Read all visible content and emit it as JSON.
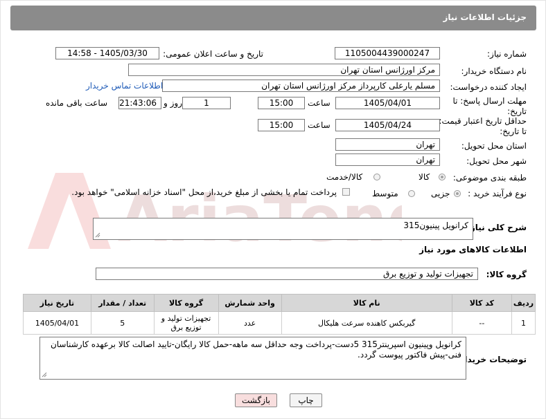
{
  "header": {
    "title": "جزئیات اطلاعات نیاز"
  },
  "form": {
    "need_number": {
      "label": "شماره نیاز:",
      "value": "1105004439000247"
    },
    "announce": {
      "label": "تاریخ و ساعت اعلان عمومی:",
      "value": "1405/03/30 - 14:58"
    },
    "buyer_org": {
      "label": "نام دستگاه خریدار:",
      "value": "مرکز اورژانس استان تهران"
    },
    "requester": {
      "label": "ایجاد کننده درخواست:",
      "value": "مسلم یارعلی کارپرداز مرکز اورژانس استان تهران",
      "contact_link": "اطلاعات تماس خریدار"
    },
    "reply_deadline": {
      "label": "مهلت ارسال پاسخ: تا تاریخ:",
      "date": "1405/04/01",
      "time_label": "ساعت",
      "time": "15:00",
      "days": "1",
      "days_label": "روز و",
      "remaining": "21:43:06",
      "remaining_label": "ساعت باقی مانده"
    },
    "price_validity": {
      "label": "حداقل تاریخ اعتبار قیمت: تا تاریخ:",
      "date": "1405/04/24",
      "time_label": "ساعت",
      "time": "15:00"
    },
    "delivery_province": {
      "label": "استان محل تحویل:",
      "value": "تهران"
    },
    "delivery_city": {
      "label": "شهر محل تحویل:",
      "value": "تهران"
    },
    "category": {
      "label": "طبقه بندی موضوعی:",
      "options": [
        "کالا",
        "کالا/خدمت"
      ],
      "selected": "کالا"
    },
    "process": {
      "label": "نوع فرآیند خرید :",
      "options": [
        "جزیی",
        "متوسط"
      ],
      "selected": "جزیی",
      "payment_note": "پرداخت تمام یا بخشی از مبلغ خرید،از محل \"اسناد خزانه اسلامی\" خواهد بود."
    }
  },
  "summary": {
    "label": "شرح کلی نیاز:",
    "value": "کرانویل پینیون315"
  },
  "goods_info": {
    "title": "اطلاعات کالاهای مورد نیاز"
  },
  "goods_group": {
    "label": "گروه کالا:",
    "value": "تجهیزات تولید و توزیع برق"
  },
  "table": {
    "headers": [
      "ردیف",
      "کد کالا",
      "نام کالا",
      "واحد شمارش",
      "گروه کالا",
      "تعداد / مقدار",
      "تاریخ نیاز"
    ],
    "rows": [
      [
        "1",
        "--",
        "گیربکس کاهنده سرعت هلیکال",
        "عدد",
        "تجهیزات تولید و توزیع برق",
        "5",
        "1405/04/01"
      ]
    ]
  },
  "buyer_notes": {
    "label": "توضیحات خریدار:",
    "value": "کرانویل وپینیون اسپرینتر315      5دست-پرداخت وجه حداقل سه ماهه-حمل کالا رایگان-تایید اصالت کالا برعهده کارشناسان فنی-پیش فاکتور پیوست گردد."
  },
  "buttons": {
    "print": "چاپ",
    "back": "بازگشت"
  },
  "watermark": {
    "text": "AriaTender.net"
  },
  "colors": {
    "header_bg": "#8b8b8b",
    "link": "#1f5bb8",
    "back_button_bg": "#f8dede",
    "table_header_bg": "#d7d7d7"
  }
}
